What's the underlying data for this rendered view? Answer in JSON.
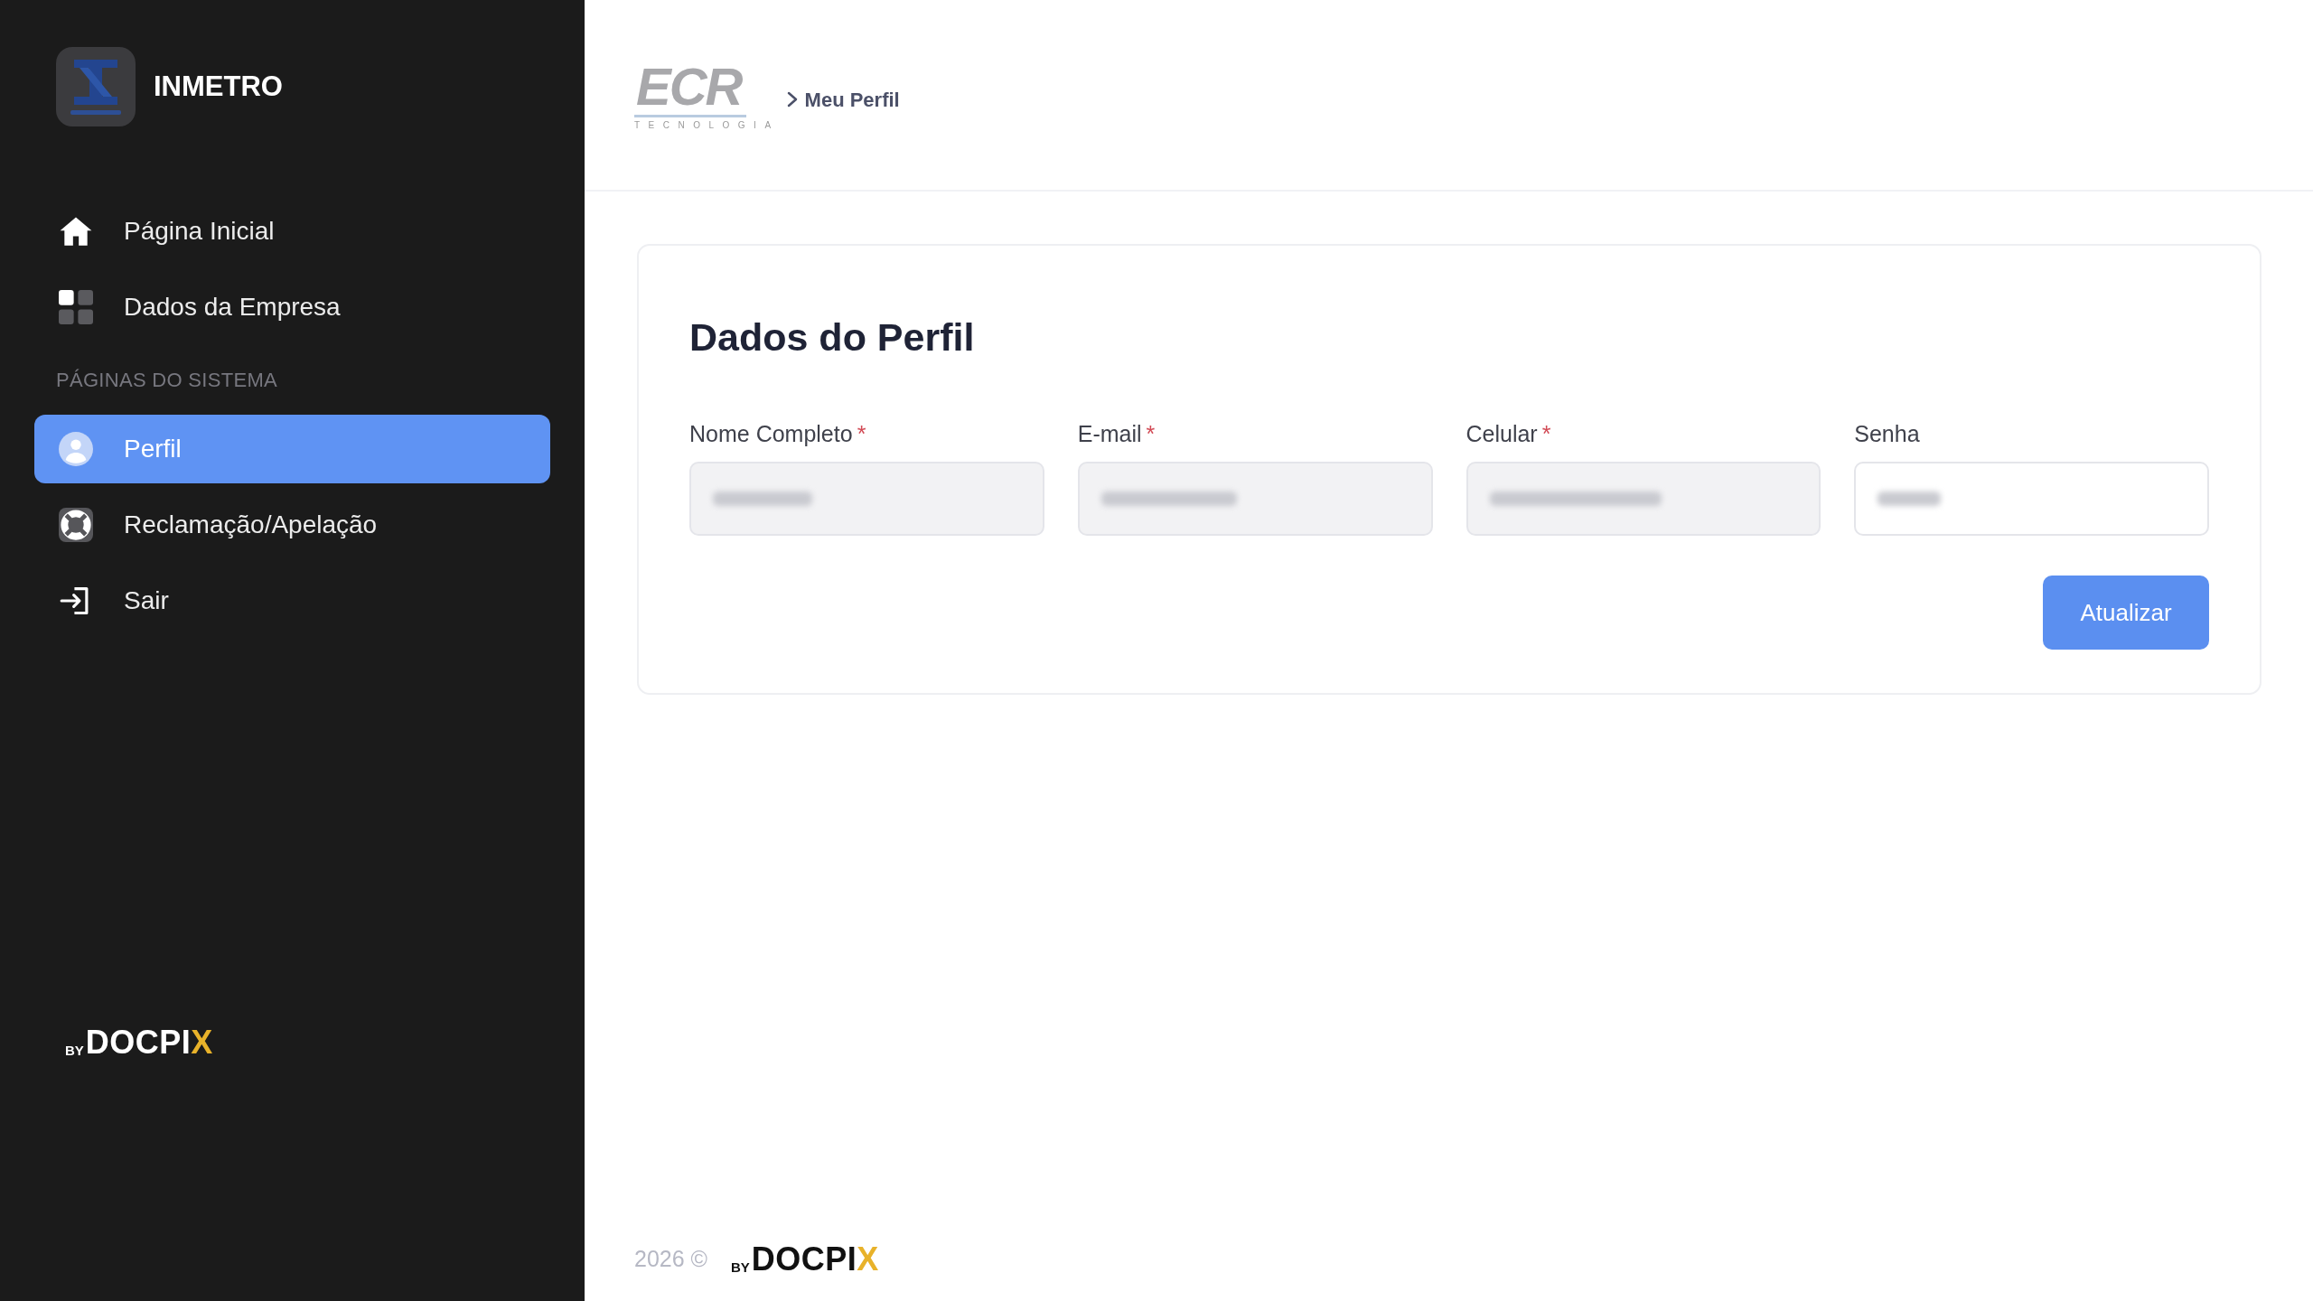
{
  "sidebar": {
    "brand": {
      "name": "INMETRO"
    },
    "nav": [
      {
        "label": "Página Inicial",
        "selected": false
      },
      {
        "label": "Dados da Empresa",
        "selected": false
      }
    ],
    "section_title": "PÁGINAS DO SISTEMA",
    "system_nav": [
      {
        "label": "Perfil",
        "selected": true
      },
      {
        "label": "Reclamação/Apelação",
        "selected": false
      },
      {
        "label": "Sair",
        "selected": false
      }
    ],
    "footer_logo": {
      "prefix": "BY",
      "name": "DOCPI",
      "accent": "X"
    }
  },
  "header": {
    "logo": {
      "name": "ECR",
      "tagline": "TECNOLOGIA"
    },
    "breadcrumb": "Meu Perfil"
  },
  "form": {
    "title": "Dados do Perfil",
    "fields": [
      {
        "label": "Nome Completo",
        "required_mark": "*",
        "disabled": true,
        "redacted": true
      },
      {
        "label": "E-mail",
        "required_mark": "*",
        "disabled": true,
        "redacted": true
      },
      {
        "label": "Celular",
        "required_mark": "*",
        "disabled": true,
        "redacted": true
      },
      {
        "label": "Senha",
        "disabled": false,
        "redacted": true
      }
    ],
    "submit": "Atualizar"
  },
  "footer": {
    "copyright": "2026 ©",
    "logo": {
      "prefix": "BY",
      "name": "DOCPI",
      "accent": "X"
    }
  }
}
